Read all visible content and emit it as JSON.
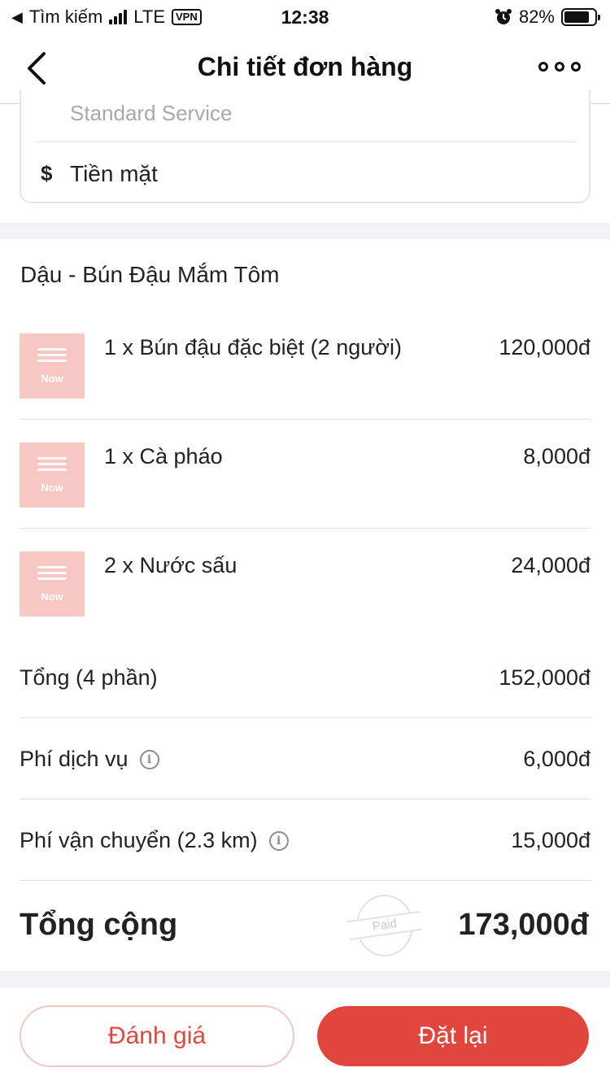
{
  "status_bar": {
    "back_app": "Tìm kiếm",
    "network": "LTE",
    "vpn": "VPN",
    "time": "12:38",
    "battery_percent": "82%",
    "battery_level": 0.82
  },
  "header": {
    "title": "Chi tiết đơn hàng",
    "back_icon": "chevron-left-icon",
    "more_icon": "more-dots-icon"
  },
  "payment": {
    "service": "Standard Service",
    "method_icon": "$",
    "method": "Tiền mặt"
  },
  "restaurant": {
    "name": "Dậu - Bún Đậu Mắm Tôm"
  },
  "items": [
    {
      "name": "1 x Bún đậu đặc biệt (2 người)",
      "price": "120,000đ",
      "thumb_label": "Now"
    },
    {
      "name": "1 x Cà pháo",
      "price": "8,000đ",
      "thumb_label": "Now"
    },
    {
      "name": "2 x Nước sấu",
      "price": "24,000đ",
      "thumb_label": "Now"
    }
  ],
  "summary": {
    "subtotal_label": "Tổng (4 phần)",
    "subtotal_value": "152,000đ",
    "service_fee_label": "Phí dịch vụ",
    "service_fee_value": "6,000đ",
    "shipping_label": "Phí vận chuyển (2.3 km)",
    "shipping_value": "15,000đ",
    "total_label": "Tổng cộng",
    "total_value": "173,000đ",
    "stamp": "Paid"
  },
  "actions": {
    "rate": "Đánh giá",
    "reorder": "Đặt lại"
  },
  "colors": {
    "accent": "#e0463d",
    "thumb": "#f6c7c3",
    "divider": "#e2e2e2"
  }
}
